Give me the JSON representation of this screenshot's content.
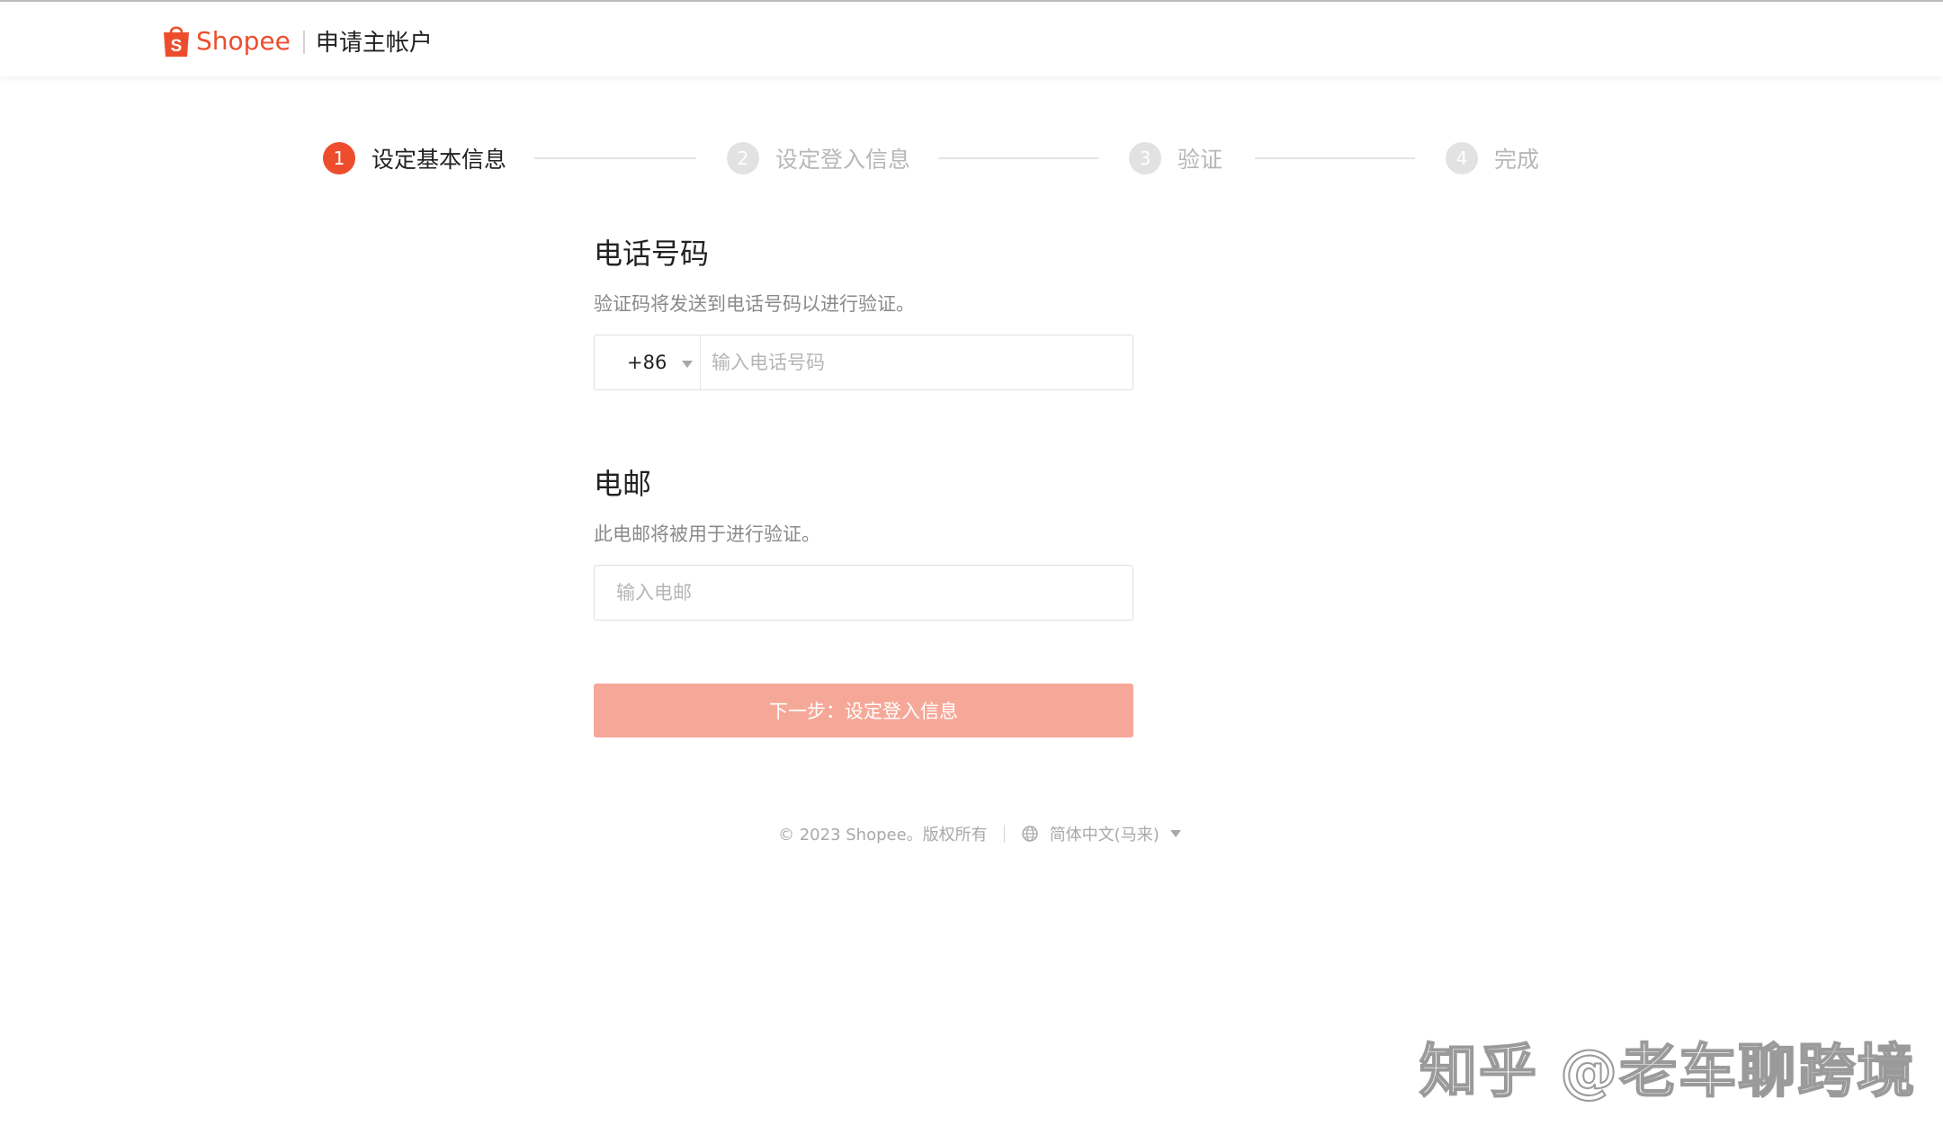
{
  "header": {
    "brand": "Shopee",
    "page_title": "申请主帐户"
  },
  "colors": {
    "accent": "#ee4d2d",
    "button_disabled": "#f6a898",
    "step_inactive": "#e2e2e2"
  },
  "stepper": {
    "current_step": 1,
    "steps": [
      {
        "number": "1",
        "label": "设定基本信息"
      },
      {
        "number": "2",
        "label": "设定登入信息"
      },
      {
        "number": "3",
        "label": "验证"
      },
      {
        "number": "4",
        "label": "完成"
      }
    ]
  },
  "phone": {
    "title": "电话号码",
    "description": "验证码将发送到电话号码以进行验证。",
    "country_code": "+86",
    "placeholder": "输入电话号码",
    "value": ""
  },
  "email": {
    "title": "电邮",
    "description": "此电邮将被用于进行验证。",
    "placeholder": "输入电邮",
    "value": ""
  },
  "next_button": {
    "label": "下一步：设定登入信息"
  },
  "footer": {
    "copyright": "© 2023 Shopee。版权所有",
    "language": "简体中文(马来)"
  },
  "watermark": {
    "text": "知乎 @老车聊跨境"
  }
}
